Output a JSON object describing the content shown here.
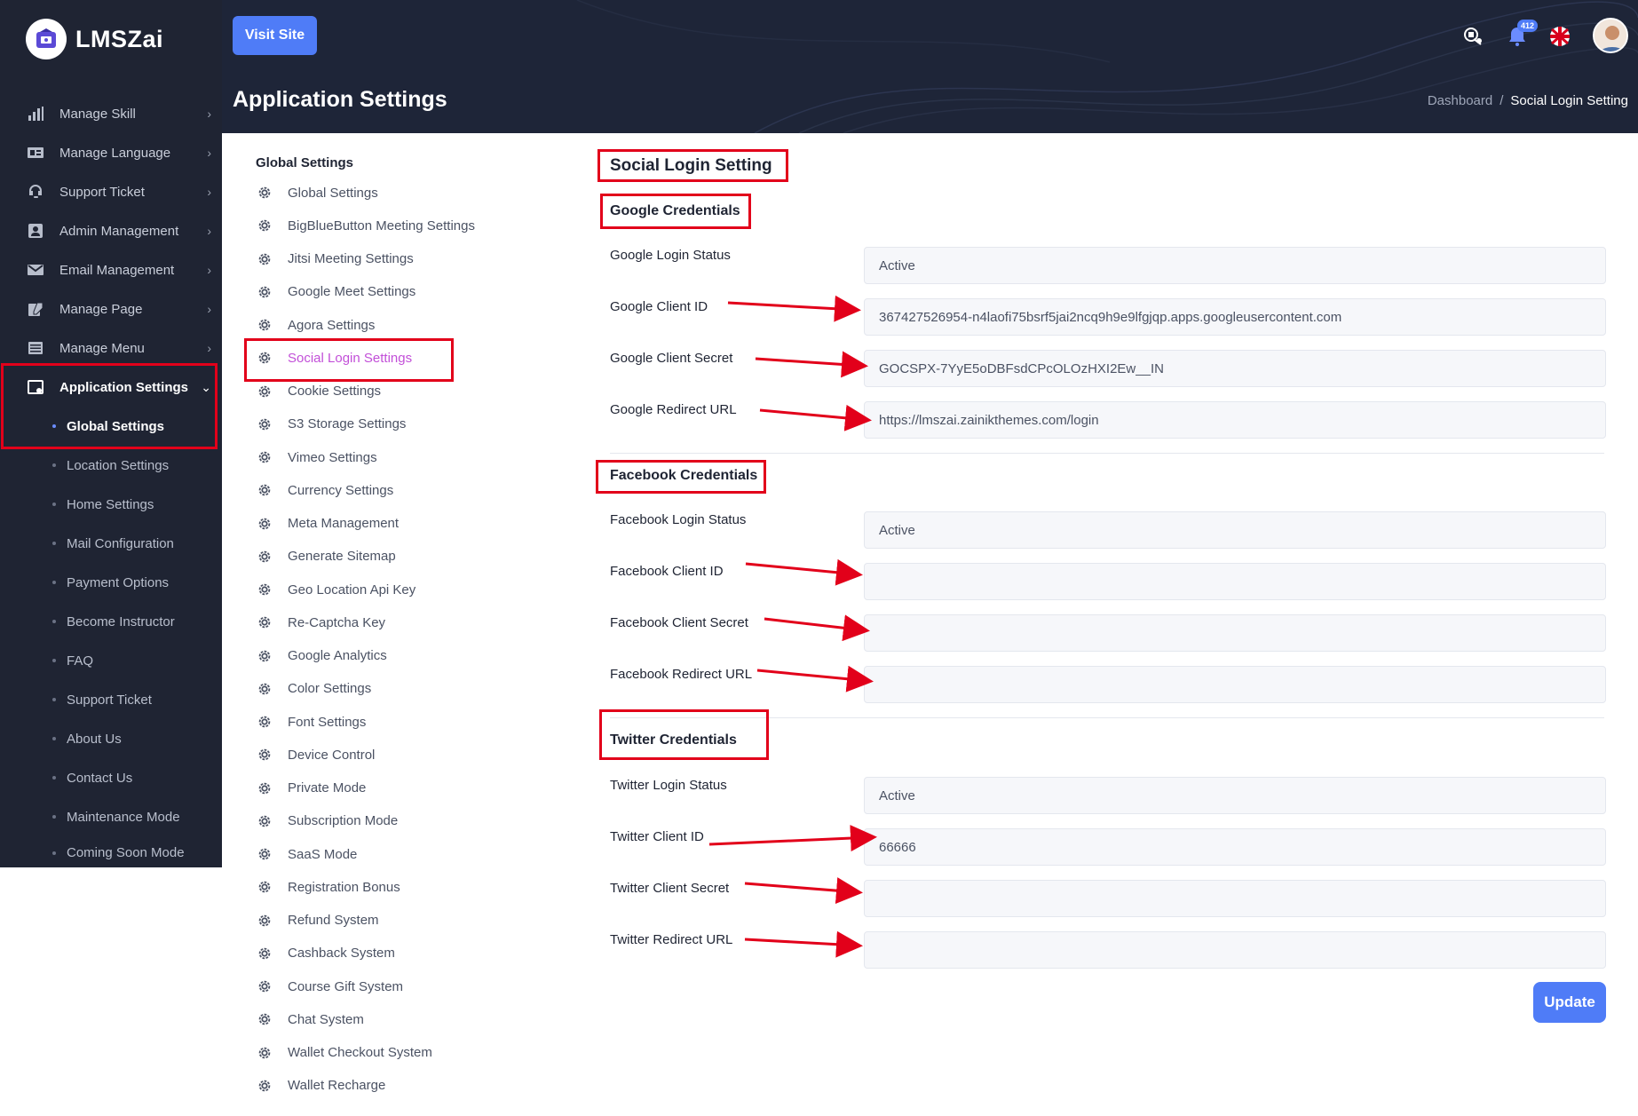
{
  "app": {
    "name": "LMSZai"
  },
  "sidebar": {
    "items": [
      {
        "label": "Manage Skill",
        "icon": "bar-chart-icon"
      },
      {
        "label": "Manage Language",
        "icon": "language-icon"
      },
      {
        "label": "Support Ticket",
        "icon": "headset-icon"
      },
      {
        "label": "Admin Management",
        "icon": "admin-icon"
      },
      {
        "label": "Email Management",
        "icon": "envelope-icon"
      },
      {
        "label": "Manage Page",
        "icon": "edit-page-icon"
      },
      {
        "label": "Manage Menu",
        "icon": "menu-icon"
      },
      {
        "label": "Application Settings",
        "icon": "settings-window-icon"
      }
    ],
    "submenu": [
      "Global Settings",
      "Location Settings",
      "Home Settings",
      "Mail Configuration",
      "Payment Options",
      "Become Instructor",
      "FAQ",
      "Support Ticket",
      "About Us",
      "Contact Us",
      "Maintenance Mode",
      "Coming Soon Mode"
    ]
  },
  "header": {
    "visit_site": "Visit Site",
    "page_title": "Application Settings",
    "breadcrumb": {
      "home": "Dashboard",
      "separator": "/",
      "current": "Social Login Setting"
    },
    "notification_count": "412"
  },
  "settings_nav": {
    "heading": "Global Settings",
    "links": [
      "Global Settings",
      "BigBlueButton Meeting Settings",
      "Jitsi Meeting Settings",
      "Google Meet Settings",
      "Agora Settings",
      "Social Login Settings",
      "Cookie Settings",
      "S3 Storage Settings",
      "Vimeo Settings",
      "Currency Settings",
      "Meta Management",
      "Generate Sitemap",
      "Geo Location Api Key",
      "Re-Captcha Key",
      "Google Analytics",
      "Color Settings",
      "Font Settings",
      "Device Control",
      "Private Mode",
      "Subscription Mode",
      "SaaS Mode",
      "Registration Bonus",
      "Refund System",
      "Cashback System",
      "Course Gift System",
      "Chat System",
      "Wallet Checkout System",
      "Wallet Recharge"
    ]
  },
  "form": {
    "title": "Social Login Setting",
    "sections": [
      {
        "title": "Google Credentials",
        "fields": [
          {
            "label": "Google Login Status",
            "value": "Active"
          },
          {
            "label": "Google Client ID",
            "value": "367427526954-n4laofi75bsrf5jai2ncq9h9e9lfgjqp.apps.googleusercontent.com"
          },
          {
            "label": "Google Client Secret",
            "value": "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"
          },
          {
            "label": "Google Redirect URL",
            "value": "https://lmszai.zainikthemes.com/login"
          }
        ]
      },
      {
        "title": "Facebook Credentials",
        "fields": [
          {
            "label": "Facebook Login Status",
            "value": "Active"
          },
          {
            "label": "Facebook Client ID",
            "value": ""
          },
          {
            "label": "Facebook Client Secret",
            "value": ""
          },
          {
            "label": "Facebook Redirect URL",
            "value": ""
          }
        ]
      },
      {
        "title": "Twitter Credentials",
        "fields": [
          {
            "label": "Twitter Login Status",
            "value": "Active"
          },
          {
            "label": "Twitter Client ID",
            "value": "66666"
          },
          {
            "label": "Twitter Client Secret",
            "value": ""
          },
          {
            "label": "Twitter Redirect URL",
            "value": ""
          }
        ]
      }
    ],
    "update_label": "Update"
  },
  "colors": {
    "sidebar_bg": "#1f2433",
    "accent": "#4f7cf7",
    "active_link": "#c24fd8",
    "highlight": "#e2001a"
  }
}
